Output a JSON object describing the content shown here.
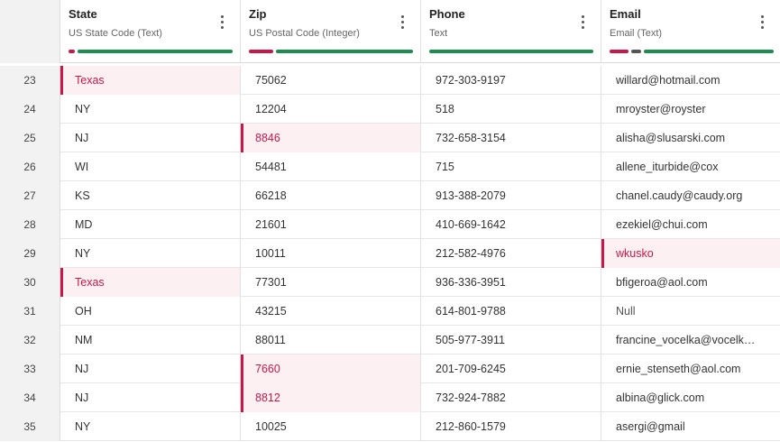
{
  "columns": [
    {
      "name": "State",
      "type": "US State Code (Text)",
      "quality": [
        {
          "color": "#c8184a",
          "fraction": 0.04
        },
        {
          "color": "#1e8c4e",
          "fraction": 0.96
        }
      ]
    },
    {
      "name": "Zip",
      "type": "US Postal Code (Integer)",
      "quality": [
        {
          "color": "#c8184a",
          "fraction": 0.15
        },
        {
          "color": "#1e8c4e",
          "fraction": 0.85
        }
      ]
    },
    {
      "name": "Phone",
      "type": "Text",
      "quality": [
        {
          "color": "#1e8c4e",
          "fraction": 1.0
        }
      ]
    },
    {
      "name": "Email",
      "type": "Email (Text)",
      "quality": [
        {
          "color": "#c8184a",
          "fraction": 0.12
        },
        {
          "color": "#555555",
          "fraction": 0.06
        },
        {
          "color": "#1e8c4e",
          "fraction": 0.82
        }
      ]
    }
  ],
  "rows": [
    {
      "index": "23",
      "state": "Texas",
      "zip": "75062",
      "phone": "972-303-9197",
      "email": "willard@hotmail.com",
      "invalid": [
        "state"
      ]
    },
    {
      "index": "24",
      "state": "NY",
      "zip": "12204",
      "phone": "518",
      "email": "mroyster@royster",
      "invalid": []
    },
    {
      "index": "25",
      "state": "NJ",
      "zip": "8846",
      "phone": "732-658-3154",
      "email": "alisha@slusarski.com",
      "invalid": [
        "zip"
      ]
    },
    {
      "index": "26",
      "state": "WI",
      "zip": "54481",
      "phone": "715",
      "email": "allene_iturbide@cox",
      "invalid": []
    },
    {
      "index": "27",
      "state": "KS",
      "zip": "66218",
      "phone": "913-388-2079",
      "email": "chanel.caudy@caudy.org",
      "invalid": []
    },
    {
      "index": "28",
      "state": "MD",
      "zip": "21601",
      "phone": "410-669-1642",
      "email": "ezekiel@chui.com",
      "invalid": []
    },
    {
      "index": "29",
      "state": "NY",
      "zip": "10011",
      "phone": "212-582-4976",
      "email": "wkusko",
      "invalid": [
        "email"
      ]
    },
    {
      "index": "30",
      "state": "Texas",
      "zip": "77301",
      "phone": "936-336-3951",
      "email": "bfigeroa@aol.com",
      "invalid": [
        "state"
      ]
    },
    {
      "index": "31",
      "state": "OH",
      "zip": "43215",
      "phone": "614-801-9788",
      "email": "Null",
      "invalid": [],
      "null": [
        "email"
      ]
    },
    {
      "index": "32",
      "state": "NM",
      "zip": "88011",
      "phone": "505-977-3911",
      "email": "francine_vocelka@vocelk…",
      "invalid": []
    },
    {
      "index": "33",
      "state": "NJ",
      "zip": "7660",
      "phone": "201-709-6245",
      "email": "ernie_stenseth@aol.com",
      "invalid": [
        "zip"
      ]
    },
    {
      "index": "34",
      "state": "NJ",
      "zip": "8812",
      "phone": "732-924-7882",
      "email": "albina@glick.com",
      "invalid": [
        "zip"
      ]
    },
    {
      "index": "35",
      "state": "NY",
      "zip": "10025",
      "phone": "212-860-1579",
      "email": "asergi@gmail",
      "invalid": []
    }
  ]
}
